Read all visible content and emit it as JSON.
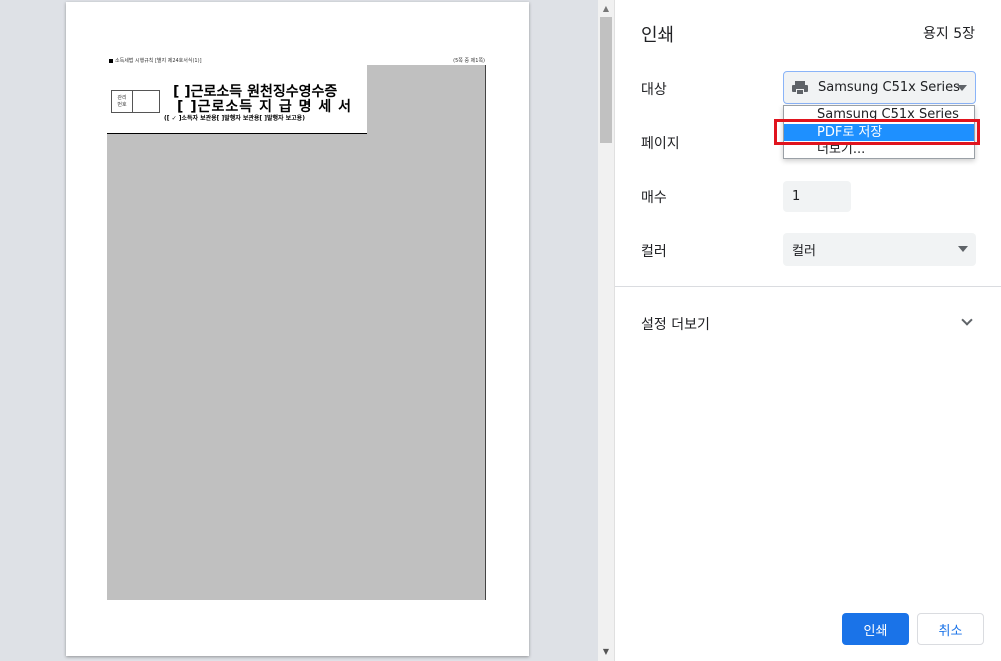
{
  "preview": {
    "header_left": "소득세법 시행규칙 [별지 제24호서식(1)]",
    "header_right": "(5쪽 중 제1쪽)",
    "management_label": "관리\n번호",
    "title_line1": "[  ]근로소득 원천징수영수증",
    "title_line2": "[  ]근로소득 지 급 명 세 서",
    "subtitle": "([ ✓ ]소득자 보관용[   ]발행자 보관용[   ]발행자 보고용)"
  },
  "scrollbar": {
    "up_arrow": "▲",
    "down_arrow": "▼"
  },
  "settings": {
    "title": "인쇄",
    "sheet_count": "용지 5장",
    "destination_label": "대상",
    "destination_value": "Samsung C51x Series",
    "destination_options": [
      "Samsung C51x Series",
      "PDF로 저장",
      "더보기..."
    ],
    "pages_label": "페이지",
    "copies_label": "매수",
    "copies_value": "1",
    "color_label": "컬러",
    "color_value": "컬러",
    "more_settings": "설정 더보기",
    "print_button": "인쇄",
    "cancel_button": "취소"
  },
  "colors": {
    "accent": "#1a73e8",
    "highlight_option": "#1e90ff",
    "annotation_box": "#e0141e"
  }
}
